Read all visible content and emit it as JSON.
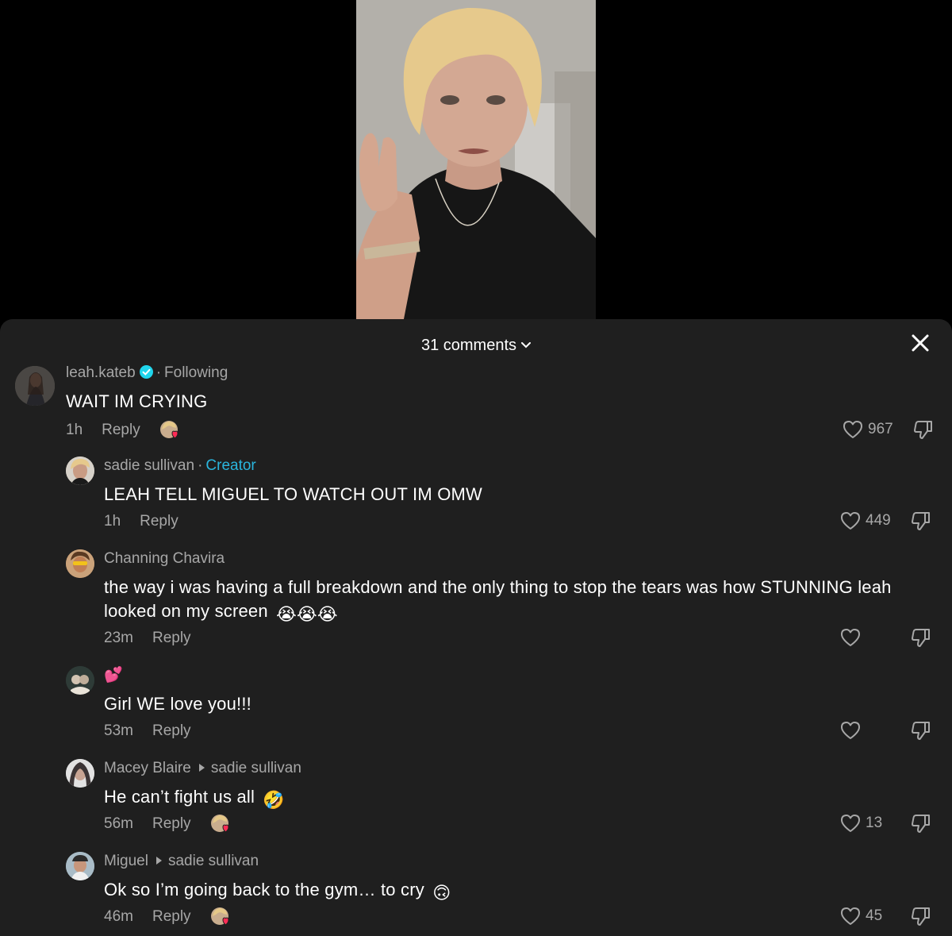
{
  "header": {
    "comment_count_label": "31 comments"
  },
  "comments": [
    {
      "username": "leah.kateb",
      "verified": true,
      "tag": "Following",
      "text": "WAIT IM CRYING",
      "time": "1h",
      "reply_label": "Reply",
      "likes": "967"
    },
    {
      "username": "sadie sullivan",
      "tag": "Creator",
      "text": "LEAH TELL MIGUEL TO WATCH OUT IM OMW",
      "time": "1h",
      "reply_label": "Reply",
      "likes": "449"
    },
    {
      "username": "Channing Chavira",
      "text": "the way i was having a full breakdown and the only thing to stop the tears was how STUNNING leah looked on my screen",
      "emoji": "😭😭😭",
      "time": "23m",
      "reply_label": "Reply",
      "likes": ""
    },
    {
      "username": "",
      "emoji_line": "💕",
      "text": "Girl WE love you!!!",
      "time": "53m",
      "reply_label": "Reply",
      "likes": ""
    },
    {
      "username": "Macey Blaire",
      "reply_to": "sadie sullivan",
      "text": "He can’t fight us all",
      "emoji": "🤣",
      "time": "56m",
      "reply_label": "Reply",
      "likes": "13"
    },
    {
      "username": "Miguel",
      "reply_to": "sadie sullivan",
      "text": "Ok so I’m going back to the gym… to cry",
      "emoji": "🙃",
      "time": "46m",
      "reply_label": "Reply",
      "likes": "45"
    }
  ],
  "icons": {
    "close": "close-icon",
    "chevron": "chevron-down-icon",
    "like": "heart-icon",
    "dislike": "thumbs-down-icon",
    "verified": "verified-badge-icon"
  },
  "colors": {
    "sheet_bg": "#1f1f1f",
    "muted_text": "#a7a7a7",
    "creator_accent": "#2ab5dd",
    "verified_badge": "#20d5ec",
    "liked_heart": "#fe2c55"
  }
}
